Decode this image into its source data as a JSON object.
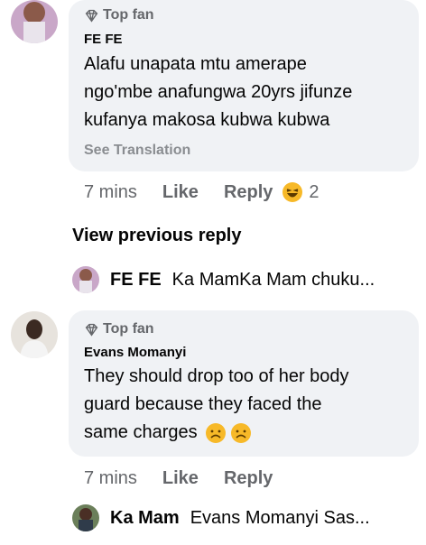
{
  "comments": [
    {
      "badge": "Top fan",
      "author": "FE FE",
      "text_lines": [
        "Alafu unapata mtu amerape",
        "ngo'mbe anafungwa 20yrs jifunze",
        "kufanya makosa kubwa kubwa"
      ],
      "see_translation": "See Translation",
      "time": "7 mins",
      "like": "Like",
      "reply": "Reply",
      "reaction_count": "2"
    },
    {
      "badge": "Top fan",
      "author": "Evans Momanyi",
      "text_lines": [
        "They should drop too of her body",
        "guard because they faced the",
        "same charges"
      ],
      "time": "7 mins",
      "like": "Like",
      "reply": "Reply"
    }
  ],
  "view_previous": "View previous reply",
  "replies": [
    {
      "name": "FE FE",
      "snippet": "Ka MamKa Mam chuku..."
    },
    {
      "name": "Ka Mam",
      "snippet": "Evans Momanyi  Sas..."
    }
  ],
  "colors": {
    "bubble": "#f0f2f5",
    "secondary": "#65676b",
    "badge": "#8a8d91"
  }
}
